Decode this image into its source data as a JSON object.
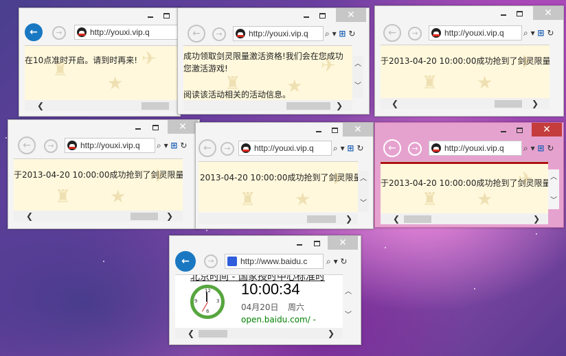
{
  "colors": {
    "accent_blue": "#1a78c2",
    "active_close": "#c43c3c",
    "content_bg": "#fff8dc",
    "clock_green": "#57a63f",
    "link_green": "#008000"
  },
  "icons": {
    "back": "back-arrow-icon",
    "forward": "forward-arrow-icon",
    "search": "search-icon",
    "dropdown": "chevron-down-icon",
    "compat": "compat-view-icon",
    "refresh": "refresh-icon",
    "favicon_qq": "qq-penguin-icon",
    "favicon_baidu": "baidu-paw-icon"
  },
  "glyphs": {
    "min": "",
    "max": "",
    "close": "✕",
    "back": "🡐",
    "back_text": "←",
    "fwd_text": "→",
    "search": "⌕",
    "dropdown": "▾",
    "compat": "⊞",
    "refresh": "↻",
    "left": "❮",
    "right": "❯",
    "up": "❮",
    "down": "❯",
    "up_text": "︿",
    "down_text": "﹀"
  },
  "windows": [
    {
      "url": "http://youxi.vip.q",
      "text1": "在10点准时开启。请到时再来!"
    },
    {
      "url": "http://youxi.vip.q",
      "text1": "成功领取剑灵限量激活资格!我们会在您成功",
      "text2": "您激活游戏!",
      "text3": "阅读该活动相关的活动信息。"
    },
    {
      "url": "http://youxi.vip.q",
      "text1": "于2013-04-20 10:00:00成功抢到了剑灵限量"
    },
    {
      "url": "http://youxi.vip.q",
      "text1": "于2013-04-20 10:00:00成功抢到了剑灵限量"
    },
    {
      "url": "http://youxi.vip.q",
      "text1": "2013-04-20 10:00:00成功抢到了剑灵限量"
    },
    {
      "url": "http://youxi.vip.q",
      "text1": "于2013-04-20 10:00:00成功抢到了剑灵限量"
    },
    {
      "url": "http://www.baidu.c",
      "top_cut": "北京时间 - 国家授时中心标准时",
      "time": "10:00:34",
      "date": "04月20日",
      "weekday": "周六",
      "link": "open.baidu.com/ -"
    }
  ],
  "clock_ticks": [
    "12",
    "3",
    "6",
    "9"
  ]
}
